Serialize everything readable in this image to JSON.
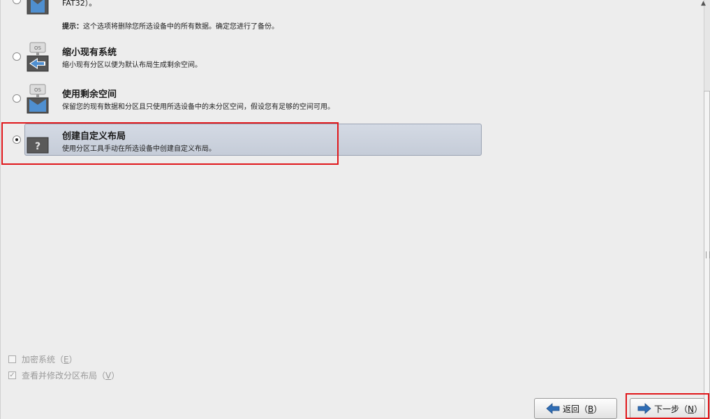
{
  "options": [
    {
      "title_partial": "FAT32）。",
      "hint_label": "提示：",
      "hint_text": "这个选项将删除您所选设备中的所有数据。确定您进行了备份。",
      "checked": false
    },
    {
      "title": "缩小现有系统",
      "desc": "缩小现有分区以便为默认布局生成剩余空间。",
      "icon_badge": "OS",
      "checked": false
    },
    {
      "title": "使用剩余空间",
      "desc": "保留您的现有数据和分区且只使用所选设备中的未分区空间，假设您有足够的空间可用。",
      "icon_badge": "OS",
      "checked": false
    },
    {
      "title": "创建自定义布局",
      "desc": "使用分区工具手动在所选设备中创建自定义布局。",
      "icon_glyph": "?",
      "checked": true
    }
  ],
  "checkboxes": [
    {
      "label_pre": "加密系统（",
      "mnemonic": "E",
      "label_post": "）",
      "checked": false
    },
    {
      "label_pre": "查看并修改分区布局（",
      "mnemonic": "V",
      "label_post": "）",
      "checked": true
    }
  ],
  "buttons": {
    "back": {
      "pre": "返回（",
      "mnemonic": "B",
      "post": "）"
    },
    "next": {
      "pre": "下一步（",
      "mnemonic": "N",
      "post": "）"
    }
  },
  "colors": {
    "highlight": "#e0171b",
    "selected_bg": "#c9d0dc",
    "arrow_blue": "#2f6db5"
  }
}
